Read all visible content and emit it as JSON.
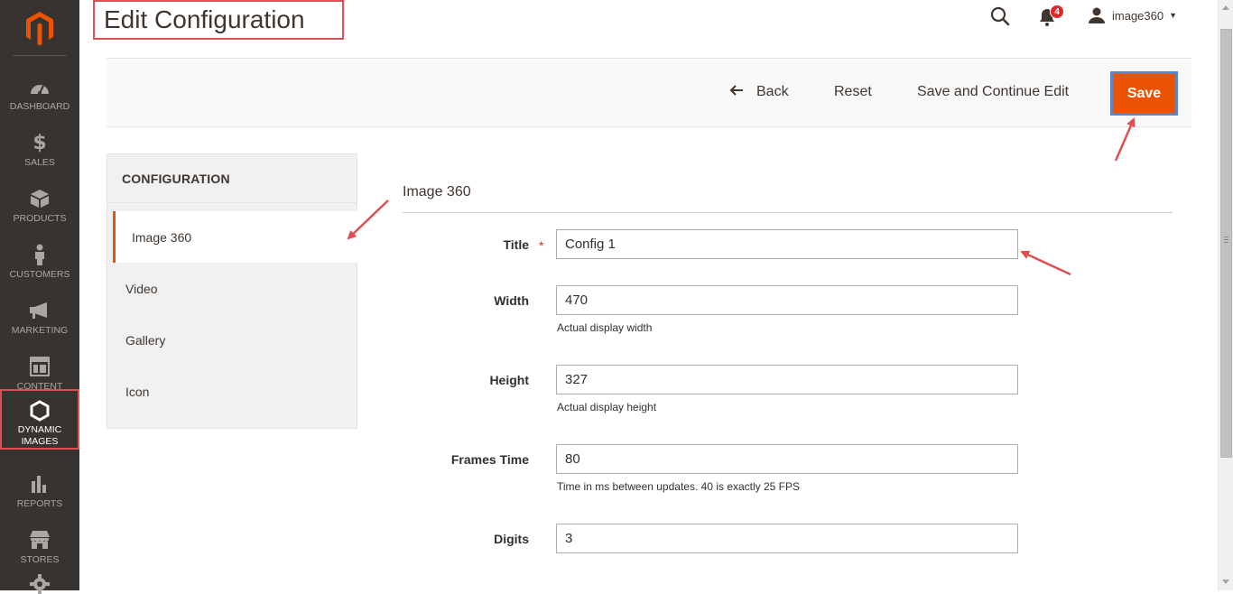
{
  "colors": {
    "sidebar_bg": "#373330",
    "accent": "#eb5202",
    "annotation": "#e04f4f",
    "save_outline": "#5b86c6",
    "badge": "#e22626"
  },
  "sidebar": {
    "logo_icon": "magento-logo-icon",
    "items": [
      {
        "label": "DASHBOARD",
        "icon": "dashboard-icon"
      },
      {
        "label": "SALES",
        "icon": "dollar-icon"
      },
      {
        "label": "PRODUCTS",
        "icon": "box-icon"
      },
      {
        "label": "CUSTOMERS",
        "icon": "person-icon"
      },
      {
        "label": "MARKETING",
        "icon": "megaphone-icon"
      },
      {
        "label": "CONTENT",
        "icon": "layout-icon"
      },
      {
        "label": "DYNAMIC IMAGES",
        "label_line1": "DYNAMIC",
        "label_line2": "IMAGES",
        "icon": "hexagon-icon",
        "active": true
      },
      {
        "label": "REPORTS",
        "icon": "bar-chart-icon"
      },
      {
        "label": "STORES",
        "icon": "store-icon"
      },
      {
        "label": "",
        "icon": "gear-icon"
      }
    ]
  },
  "header": {
    "page_title": "Edit Configuration",
    "notifications_count": "4",
    "username": "image360"
  },
  "actions": {
    "back": "Back",
    "reset": "Reset",
    "save_continue": "Save and Continue Edit",
    "save": "Save"
  },
  "tabs": {
    "heading": "CONFIGURATION",
    "items": [
      "Image 360",
      "Video",
      "Gallery",
      "Icon"
    ],
    "active": "Image 360"
  },
  "form": {
    "section_title": "Image 360",
    "fields": {
      "title": {
        "label": "Title",
        "value": "Config 1",
        "required": true
      },
      "width": {
        "label": "Width",
        "value": "470",
        "note": "Actual display width"
      },
      "height": {
        "label": "Height",
        "value": "327",
        "note": "Actual display height"
      },
      "frames_time": {
        "label": "Frames Time",
        "value": "80",
        "note": "Time in ms between updates. 40 is exactly 25 FPS"
      },
      "digits": {
        "label": "Digits",
        "value": "3"
      }
    }
  }
}
